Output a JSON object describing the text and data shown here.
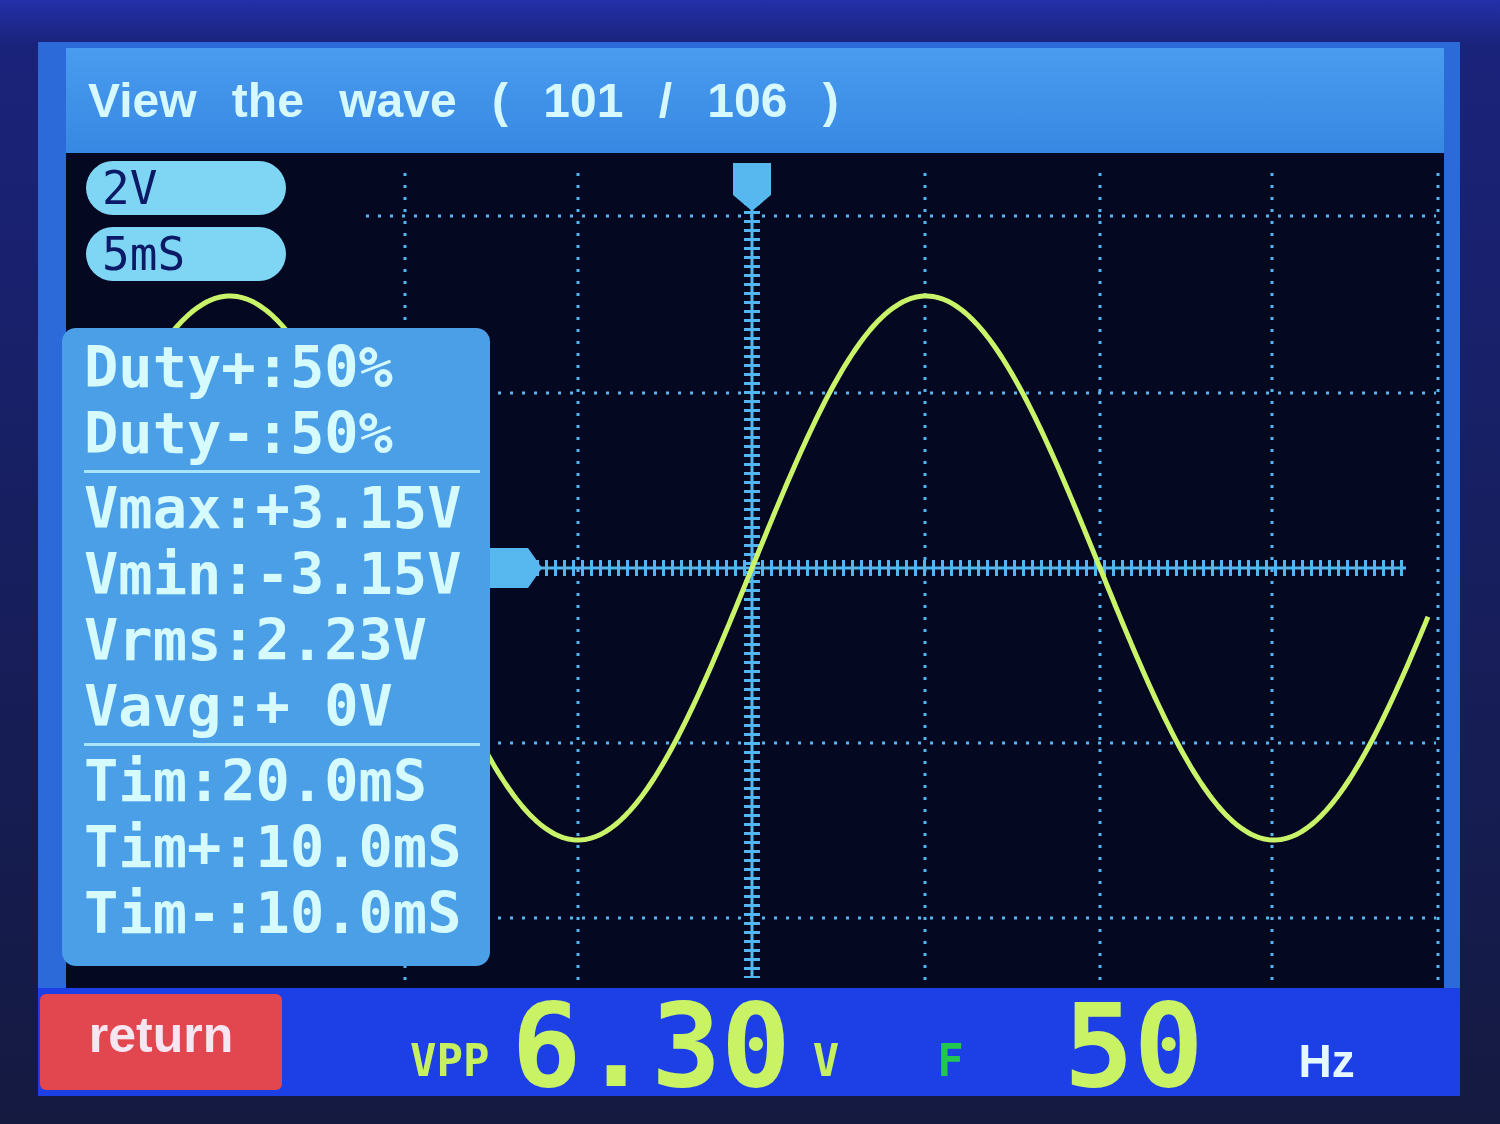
{
  "title_bar": {
    "title": "View the wave ( 101 / 106 )"
  },
  "plot": {
    "scale_badges": [
      {
        "label": "2V"
      },
      {
        "label": "5mS"
      }
    ],
    "measurement_groups": [
      [
        "Duty+:50%",
        "Duty-:50%"
      ],
      [
        "Vmax:+3.15V",
        "Vmin:-3.15V",
        "Vrms:2.23V",
        "Vavg:+ 0V"
      ],
      [
        "Tim:20.0mS",
        "Tim+:10.0mS",
        "Tim-:10.0mS"
      ]
    ]
  },
  "bottom_bar": {
    "return_button": "return",
    "vpp": {
      "label": "VPP",
      "value": "6.30",
      "unit": "V"
    },
    "frequency": {
      "label": "F",
      "value": "50",
      "unit": "Hz"
    }
  }
}
